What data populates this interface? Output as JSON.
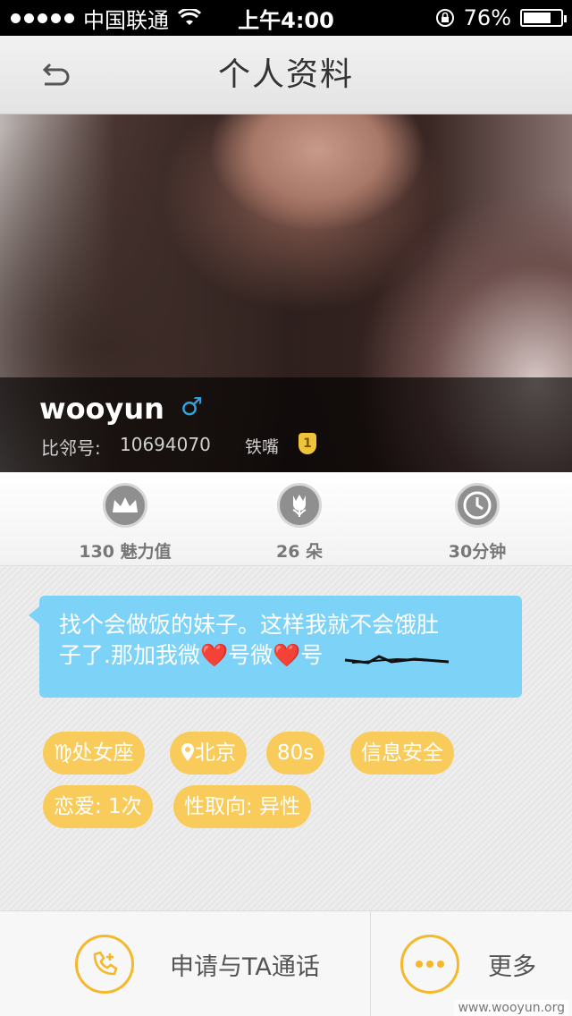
{
  "status_bar": {
    "carrier": "中国联通",
    "time": "上午4:00",
    "battery_percent": "76%",
    "battery_level": 0.76
  },
  "nav": {
    "title": "个人资料",
    "back_icon": "back-arrow-icon"
  },
  "profile": {
    "name": "wooyun",
    "gender_symbol": "♂",
    "id_label": "比邻号:",
    "id_value": "10694070",
    "title_badge": "铁嘴",
    "medal_text": "1"
  },
  "stats": [
    {
      "icon": "crown-icon",
      "label": "130 魅力值"
    },
    {
      "icon": "flower-icon",
      "label": "26 朵"
    },
    {
      "icon": "clock-icon",
      "label": "30分钟"
    }
  ],
  "bio": {
    "line1": "找个会做饭的妹子。这样我就不会饿肚",
    "line2_a": "子了.那加我微",
    "heart": "❤️",
    "line2_b": "号微",
    "line2_c": "号"
  },
  "tags": [
    {
      "label": "♍处女座"
    },
    {
      "label": "北京"
    },
    {
      "label": "80s"
    },
    {
      "label": "信息安全"
    },
    {
      "label": "恋爱: 1次"
    },
    {
      "label": "性取向: 异性"
    }
  ],
  "colors": {
    "accent": "#f4b82b",
    "tag_bg": "#f8cb5a",
    "bubble_bg": "#7dd3f7",
    "gender": "#2fa3e0"
  },
  "bottom": {
    "call_label": "申请与TA通话",
    "more_label": "更多"
  },
  "watermark": "www.wooyun.org"
}
